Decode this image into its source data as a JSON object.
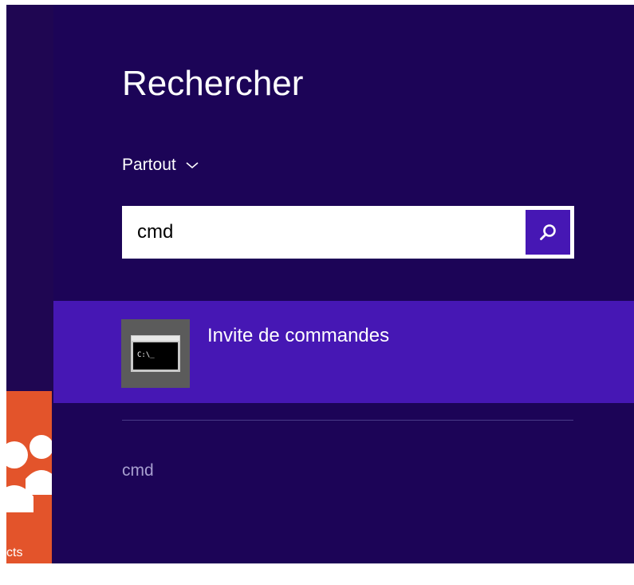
{
  "search_pane": {
    "title": "Rechercher",
    "scope_label": "Partout",
    "query": "cmd",
    "search_button_icon": "search-icon"
  },
  "results": [
    {
      "label": "Invite de commandes",
      "icon": "command-prompt-icon",
      "icon_text": "C:\\_"
    }
  ],
  "suggestions": [
    {
      "label": "cmd"
    }
  ],
  "start_tile": {
    "label": "cts",
    "icon": "people-icon"
  },
  "colors": {
    "panel_bg": "#1c0457",
    "accent": "#4617b4",
    "tile": "#e3542b",
    "suggestion_text": "#a79fcf"
  }
}
